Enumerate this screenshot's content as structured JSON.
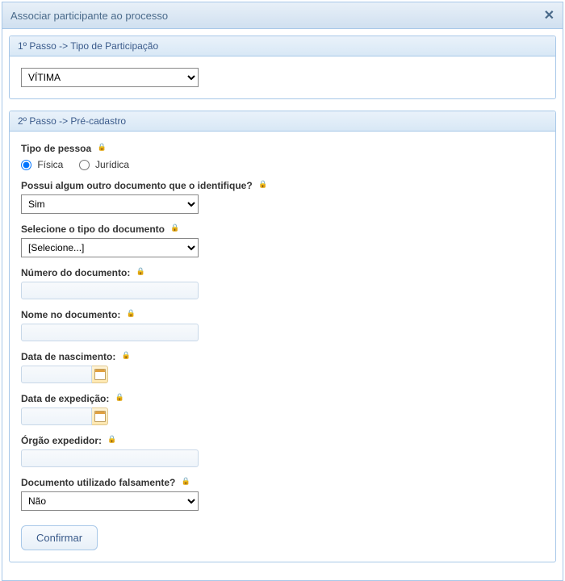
{
  "dialog": {
    "title": "Associar participante ao processo"
  },
  "step1": {
    "header": "1º Passo -> Tipo de Participação",
    "participation_type": {
      "selected": "VÍTIMA"
    }
  },
  "step2": {
    "header": "2º Passo -> Pré-cadastro",
    "person_type": {
      "label": "Tipo de pessoa",
      "option_fisica": "Física",
      "option_juridica": "Jurídica",
      "selected": "fisica"
    },
    "has_other_document": {
      "label": "Possui algum outro documento que o identifique?",
      "selected": "Sim"
    },
    "document_type": {
      "label": "Selecione o tipo do documento",
      "selected": "[Selecione...]"
    },
    "document_number": {
      "label": "Número do documento:",
      "value": ""
    },
    "document_name": {
      "label": "Nome no documento:",
      "value": ""
    },
    "birth_date": {
      "label": "Data de nascimento:",
      "value": ""
    },
    "issue_date": {
      "label": "Data de expedição:",
      "value": ""
    },
    "issuer": {
      "label": "Órgão expedidor:",
      "value": ""
    },
    "falsely_used": {
      "label": "Documento utilizado falsamente?",
      "selected": "Não"
    },
    "confirm_label": "Confirmar"
  }
}
